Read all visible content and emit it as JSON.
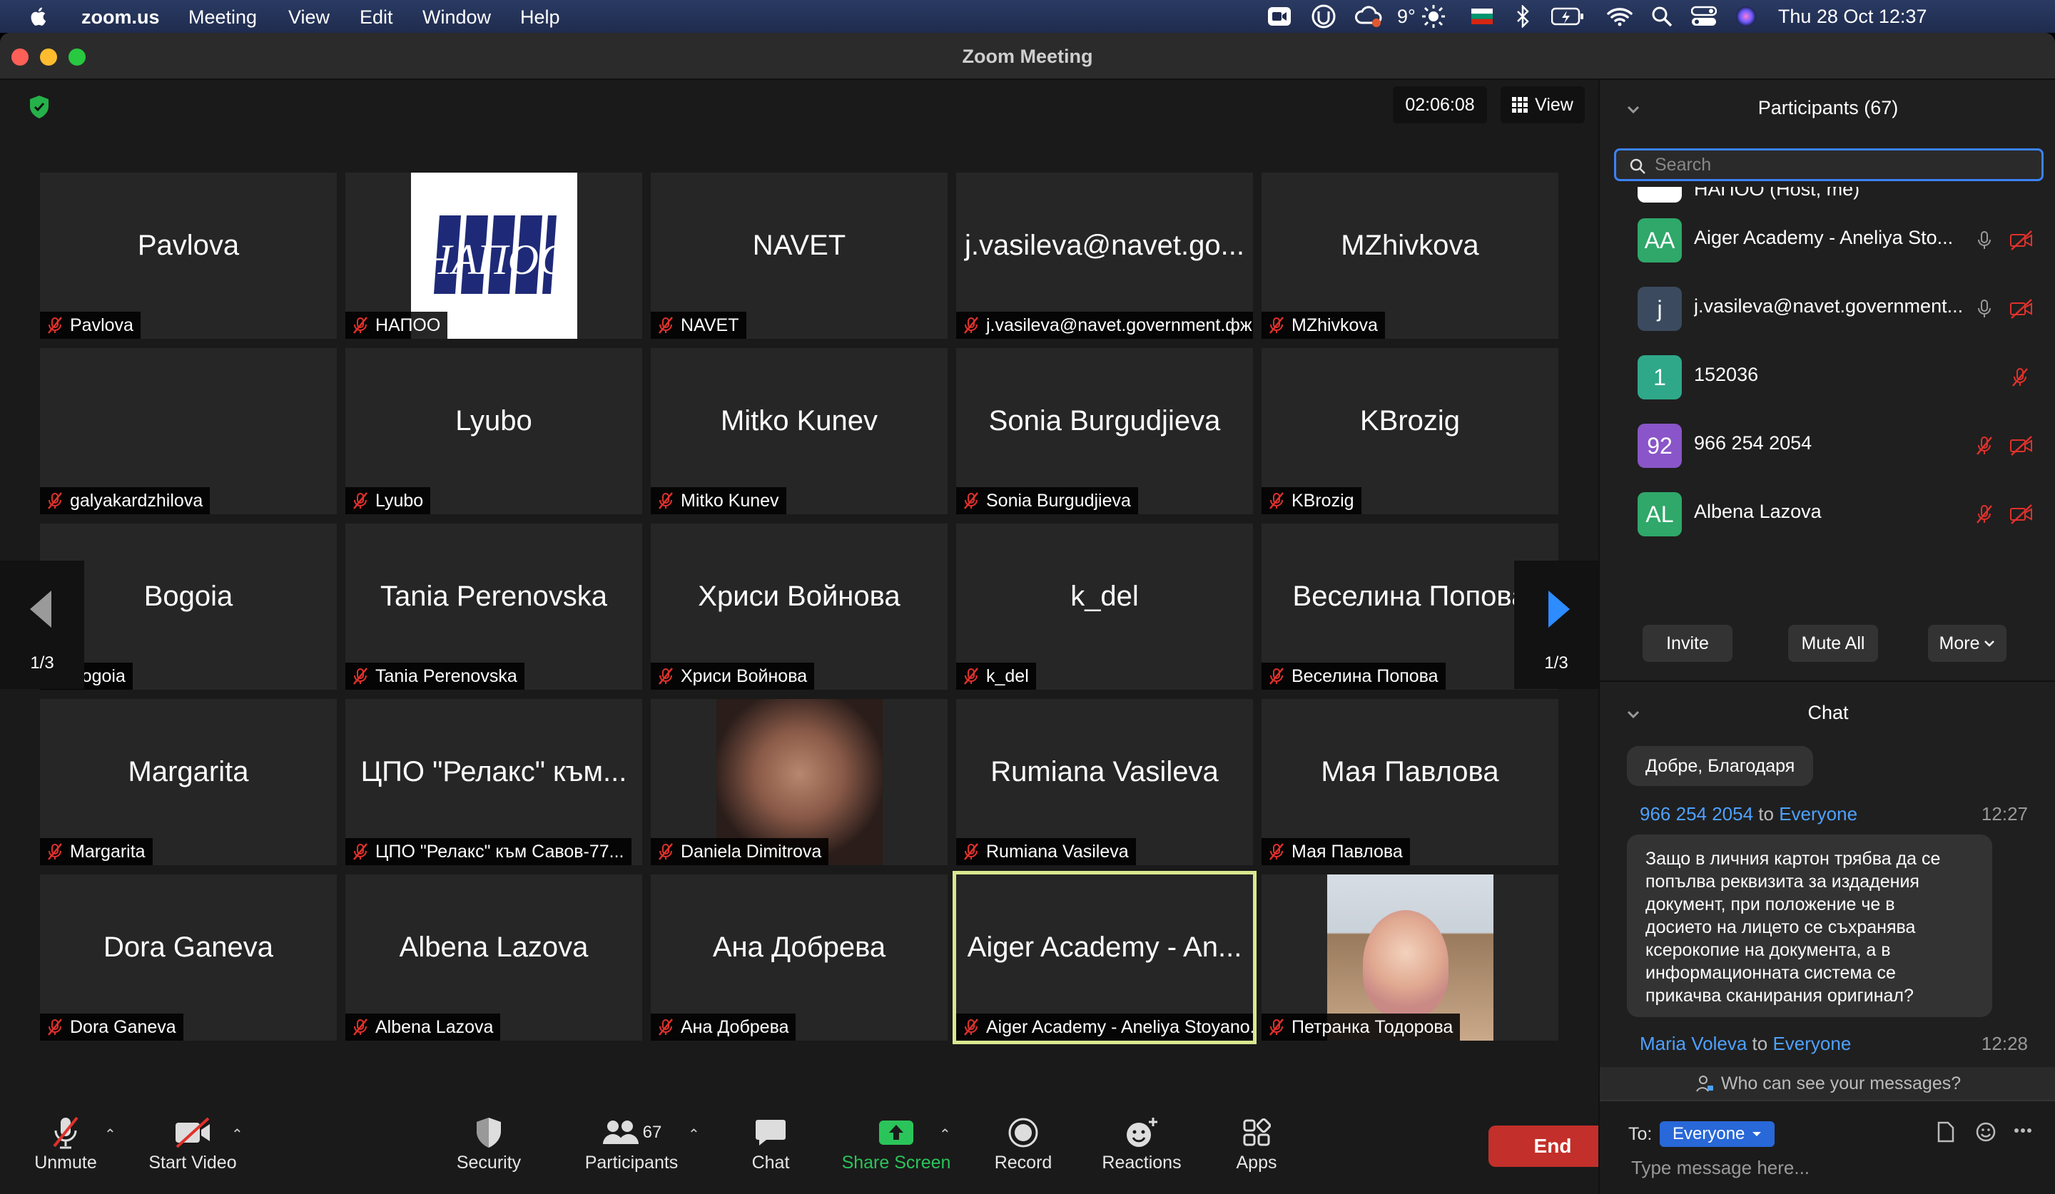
{
  "menubar": {
    "app": "zoom.us",
    "items": [
      "Meeting",
      "View",
      "Edit",
      "Window",
      "Help"
    ],
    "temp": "9°",
    "clock": "Thu 28 Oct  12:37"
  },
  "window": {
    "title": "Zoom Meeting"
  },
  "meeting": {
    "timer": "02:06:08",
    "view_label": "View",
    "page_left": "1/3",
    "page_right": "1/3"
  },
  "tiles": [
    {
      "big": "Pavlova",
      "label": "Pavlova"
    },
    {
      "big": "",
      "label": "НАПОО",
      "logo": "НАПОО"
    },
    {
      "big": "NAVET",
      "label": "NAVET"
    },
    {
      "big": "j.vasileva@navet.go...",
      "label": "j.vasileva@navet.government.фж"
    },
    {
      "big": "MZhivkova",
      "label": "MZhivkova"
    },
    {
      "big": "",
      "label": "galyakardzhilova"
    },
    {
      "big": "Lyubo",
      "label": "Lyubo"
    },
    {
      "big": "Mitko Kunev",
      "label": "Mitko Kunev"
    },
    {
      "big": "Sonia Burgudjieva",
      "label": "Sonia Burgudjieva"
    },
    {
      "big": "KBrozig",
      "label": "KBrozig"
    },
    {
      "big": "Bogoia",
      "label": "Bogoia"
    },
    {
      "big": "Tania Perenovska",
      "label": "Tania Perenovska"
    },
    {
      "big": "Хриси Войнова",
      "label": "Хриси Войнова"
    },
    {
      "big": "k_del",
      "label": "k_del"
    },
    {
      "big": "Веселина Попова",
      "label": "Веселина Попова"
    },
    {
      "big": "Margarita",
      "label": "Margarita"
    },
    {
      "big": "ЦПО \"Релакс\" към...",
      "label": "ЦПО \"Релакс\" към Савов-77..."
    },
    {
      "big": "",
      "label": "Daniela Dimitrova"
    },
    {
      "big": "Rumiana Vasileva",
      "label": "Rumiana Vasileva"
    },
    {
      "big": "Мая Павлова",
      "label": "Мая Павлова"
    },
    {
      "big": "Dora Ganeva",
      "label": "Dora Ganeva"
    },
    {
      "big": "Albena Lazova",
      "label": "Albena Lazova"
    },
    {
      "big": "Ана Добрева",
      "label": "Ана Добрева"
    },
    {
      "big": "Aiger Academy - An...",
      "label": "Aiger Academy - Aneliya Stoyano..."
    },
    {
      "big": "",
      "label": "Петранка Тодорова"
    }
  ],
  "toolbar": {
    "unmute": "Unmute",
    "start_video": "Start Video",
    "security": "Security",
    "participants": "Participants",
    "participants_count": "67",
    "chat": "Chat",
    "share_screen": "Share Screen",
    "record": "Record",
    "reactions": "Reactions",
    "apps": "Apps",
    "end": "End"
  },
  "participants": {
    "title": "Participants (67)",
    "search_placeholder": "Search",
    "host_partial": "НАПОО (Host, me)",
    "list": [
      {
        "initials": "AA",
        "name": "Aiger Academy - Aneliya Sto...",
        "color": "#2fa86a"
      },
      {
        "initials": "j",
        "name": "j.vasileva@navet.government...",
        "color": "#3b4a5e"
      },
      {
        "initials": "1",
        "name": "152036",
        "color": "#2fa88a"
      },
      {
        "initials": "92",
        "name": "966 254 2054",
        "color": "#8a55c8"
      },
      {
        "initials": "AL",
        "name": "Albena Lazova",
        "color": "#2fa86a"
      }
    ],
    "invite": "Invite",
    "mute_all": "Mute All",
    "more": "More"
  },
  "chat": {
    "title": "Chat",
    "msg0": "Добре, Благодаря",
    "sender1": "966 254 2054",
    "to_word": "to",
    "everyone": "Everyone",
    "time1": "12:27",
    "msg1": [
      "Защо в личния картон трябва да се",
      "попълва реквизита за издадения",
      "документ, при положение че в",
      "досието на лицето се съхранява",
      "ксерокопие на документа, а в",
      "информационната система се",
      "прикачва сканирания оригинал?"
    ],
    "sender2": "Maria Voleva",
    "time2": "12:28",
    "who_can_see": "Who can see your messages?",
    "to_label": "To:",
    "recipient": "Everyone",
    "input_placeholder": "Type message here..."
  }
}
